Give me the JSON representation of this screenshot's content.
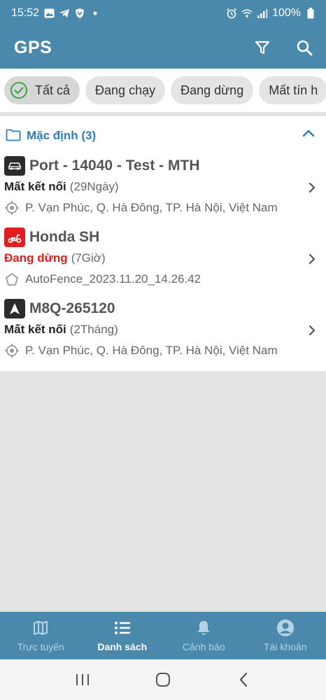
{
  "status": {
    "time": "15:52",
    "battery": "100%"
  },
  "app": {
    "title": "GPS"
  },
  "filters": [
    {
      "label": "Tất cả",
      "active": true
    },
    {
      "label": "Đang chạy"
    },
    {
      "label": "Đang dừng"
    },
    {
      "label": "Mất tín h"
    }
  ],
  "group": {
    "title": "Mặc định (3)"
  },
  "vehicles": [
    {
      "name": "Port - 14040 - Test - MTH",
      "status": "Mất kết nối",
      "duration": "(29Ngày)",
      "location": "P. Vạn Phúc, Q. Hà Đông, TP. Hà Nội, Việt Nam",
      "icon": "car-icon",
      "icon_color": "#2c2c2c",
      "status_color": "#222222",
      "location_icon": "gps-target-icon"
    },
    {
      "name": "Honda SH",
      "status": "Đang dừng",
      "duration": "(7Giờ)",
      "location": "AutoFence_2023.11.20_14.26.42",
      "icon": "scooter-icon",
      "icon_color": "#e02020",
      "status_color": "#e02020",
      "location_icon": "pentagon-fence-icon"
    },
    {
      "name": "M8Q-265120",
      "status": "Mất kết nối",
      "duration": "(2Tháng)",
      "location": "P. Vạn Phúc, Q. Hà Đông, TP. Hà Nội, Việt Nam",
      "icon": "navigation-arrow-icon",
      "icon_color": "#2c2c2c",
      "status_color": "#222222",
      "location_icon": "gps-target-icon"
    }
  ],
  "nav": [
    {
      "label": "Trực tuyến",
      "icon": "map-icon"
    },
    {
      "label": "Danh sách",
      "icon": "list-icon",
      "active": true
    },
    {
      "label": "Cảnh báo",
      "icon": "bell-icon"
    },
    {
      "label": "Tài khoản",
      "icon": "account-icon"
    }
  ],
  "colors": {
    "primary": "#4a89ac",
    "accent": "#2f7cb7",
    "danger": "#e02020",
    "check": "#3aa54a"
  }
}
